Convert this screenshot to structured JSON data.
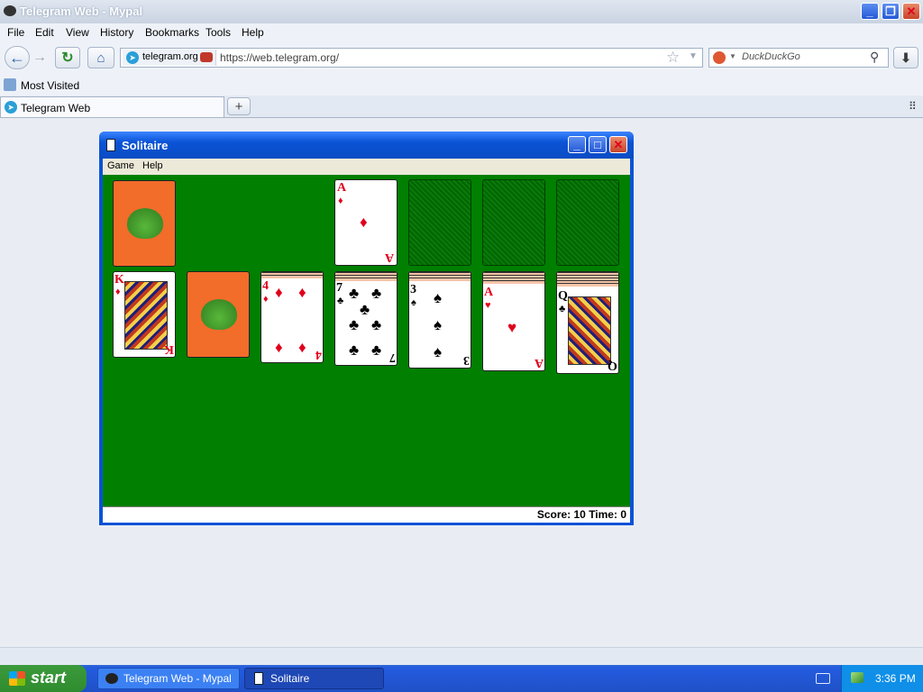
{
  "browser": {
    "title": "Telegram Web - Mypal",
    "menu": [
      "File",
      "Edit",
      "View",
      "History",
      "Bookmarks",
      "Tools",
      "Help"
    ],
    "site_identity": "telegram.org",
    "url": "https://web.telegram.org/",
    "search_placeholder": "DuckDuckGo",
    "bookmark": "Most Visited",
    "tab_label": "Telegram Web"
  },
  "solitaire": {
    "title": "Solitaire",
    "menu": [
      "Game",
      "Help"
    ],
    "status": "Score: 10 Time: 0",
    "foundation_card": {
      "rank": "A",
      "suit": "♦"
    },
    "tableau": [
      {
        "rank": "K",
        "suit": "♦",
        "face": "king-diamonds"
      },
      {
        "rank": "",
        "suit": "",
        "face": "back"
      },
      {
        "rank": "4",
        "suit": "♦"
      },
      {
        "rank": "7",
        "suit": "♣"
      },
      {
        "rank": "3",
        "suit": "♠"
      },
      {
        "rank": "A",
        "suit": "♥"
      },
      {
        "rank": "Q",
        "suit": "♣",
        "face": "queen-clubs"
      }
    ]
  },
  "taskbar": {
    "start": "start",
    "items": [
      "Telegram Web - Mypal",
      "Solitaire"
    ],
    "clock": "3:36 PM"
  },
  "colors": {
    "felt": "#007f00",
    "card_back": "#f26c2a",
    "xp_blue": "#0a53d6"
  }
}
